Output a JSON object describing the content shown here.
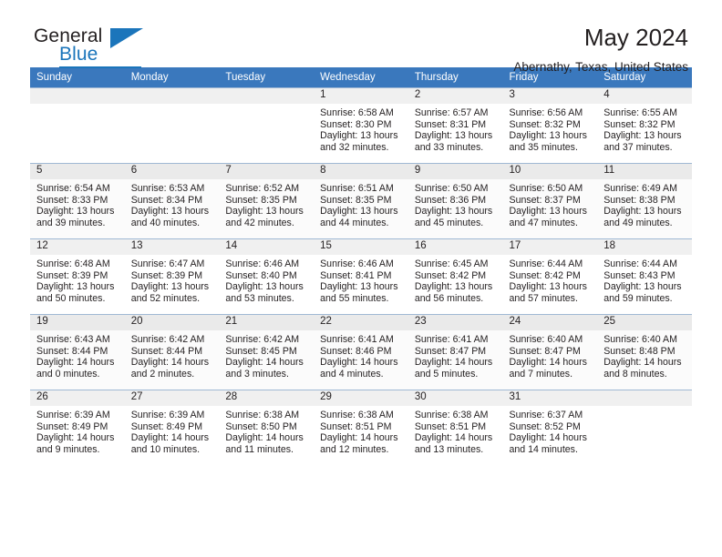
{
  "logo": {
    "word_top": "General",
    "word_bottom": "Blue",
    "icon": "triangle-mark",
    "brand_color": "#1b75bb"
  },
  "header": {
    "title": "May 2024",
    "subtitle": "Abernathy, Texas, United States"
  },
  "calendar": {
    "header_color": "#3a78bd",
    "weekday_headers": [
      "Sunday",
      "Monday",
      "Tuesday",
      "Wednesday",
      "Thursday",
      "Friday",
      "Saturday"
    ],
    "weeks": [
      [
        {
          "day": "",
          "empty": true
        },
        {
          "day": "",
          "empty": true
        },
        {
          "day": "",
          "empty": true
        },
        {
          "day": "1",
          "sunrise": "Sunrise: 6:58 AM",
          "sunset": "Sunset: 8:30 PM",
          "daylight_line1": "Daylight: 13 hours",
          "daylight_line2": "and 32 minutes."
        },
        {
          "day": "2",
          "sunrise": "Sunrise: 6:57 AM",
          "sunset": "Sunset: 8:31 PM",
          "daylight_line1": "Daylight: 13 hours",
          "daylight_line2": "and 33 minutes."
        },
        {
          "day": "3",
          "sunrise": "Sunrise: 6:56 AM",
          "sunset": "Sunset: 8:32 PM",
          "daylight_line1": "Daylight: 13 hours",
          "daylight_line2": "and 35 minutes."
        },
        {
          "day": "4",
          "sunrise": "Sunrise: 6:55 AM",
          "sunset": "Sunset: 8:32 PM",
          "daylight_line1": "Daylight: 13 hours",
          "daylight_line2": "and 37 minutes."
        }
      ],
      [
        {
          "day": "5",
          "sunrise": "Sunrise: 6:54 AM",
          "sunset": "Sunset: 8:33 PM",
          "daylight_line1": "Daylight: 13 hours",
          "daylight_line2": "and 39 minutes."
        },
        {
          "day": "6",
          "sunrise": "Sunrise: 6:53 AM",
          "sunset": "Sunset: 8:34 PM",
          "daylight_line1": "Daylight: 13 hours",
          "daylight_line2": "and 40 minutes."
        },
        {
          "day": "7",
          "sunrise": "Sunrise: 6:52 AM",
          "sunset": "Sunset: 8:35 PM",
          "daylight_line1": "Daylight: 13 hours",
          "daylight_line2": "and 42 minutes."
        },
        {
          "day": "8",
          "sunrise": "Sunrise: 6:51 AM",
          "sunset": "Sunset: 8:35 PM",
          "daylight_line1": "Daylight: 13 hours",
          "daylight_line2": "and 44 minutes."
        },
        {
          "day": "9",
          "sunrise": "Sunrise: 6:50 AM",
          "sunset": "Sunset: 8:36 PM",
          "daylight_line1": "Daylight: 13 hours",
          "daylight_line2": "and 45 minutes."
        },
        {
          "day": "10",
          "sunrise": "Sunrise: 6:50 AM",
          "sunset": "Sunset: 8:37 PM",
          "daylight_line1": "Daylight: 13 hours",
          "daylight_line2": "and 47 minutes."
        },
        {
          "day": "11",
          "sunrise": "Sunrise: 6:49 AM",
          "sunset": "Sunset: 8:38 PM",
          "daylight_line1": "Daylight: 13 hours",
          "daylight_line2": "and 49 minutes."
        }
      ],
      [
        {
          "day": "12",
          "sunrise": "Sunrise: 6:48 AM",
          "sunset": "Sunset: 8:39 PM",
          "daylight_line1": "Daylight: 13 hours",
          "daylight_line2": "and 50 minutes."
        },
        {
          "day": "13",
          "sunrise": "Sunrise: 6:47 AM",
          "sunset": "Sunset: 8:39 PM",
          "daylight_line1": "Daylight: 13 hours",
          "daylight_line2": "and 52 minutes."
        },
        {
          "day": "14",
          "sunrise": "Sunrise: 6:46 AM",
          "sunset": "Sunset: 8:40 PM",
          "daylight_line1": "Daylight: 13 hours",
          "daylight_line2": "and 53 minutes."
        },
        {
          "day": "15",
          "sunrise": "Sunrise: 6:46 AM",
          "sunset": "Sunset: 8:41 PM",
          "daylight_line1": "Daylight: 13 hours",
          "daylight_line2": "and 55 minutes."
        },
        {
          "day": "16",
          "sunrise": "Sunrise: 6:45 AM",
          "sunset": "Sunset: 8:42 PM",
          "daylight_line1": "Daylight: 13 hours",
          "daylight_line2": "and 56 minutes."
        },
        {
          "day": "17",
          "sunrise": "Sunrise: 6:44 AM",
          "sunset": "Sunset: 8:42 PM",
          "daylight_line1": "Daylight: 13 hours",
          "daylight_line2": "and 57 minutes."
        },
        {
          "day": "18",
          "sunrise": "Sunrise: 6:44 AM",
          "sunset": "Sunset: 8:43 PM",
          "daylight_line1": "Daylight: 13 hours",
          "daylight_line2": "and 59 minutes."
        }
      ],
      [
        {
          "day": "19",
          "sunrise": "Sunrise: 6:43 AM",
          "sunset": "Sunset: 8:44 PM",
          "daylight_line1": "Daylight: 14 hours",
          "daylight_line2": "and 0 minutes."
        },
        {
          "day": "20",
          "sunrise": "Sunrise: 6:42 AM",
          "sunset": "Sunset: 8:44 PM",
          "daylight_line1": "Daylight: 14 hours",
          "daylight_line2": "and 2 minutes."
        },
        {
          "day": "21",
          "sunrise": "Sunrise: 6:42 AM",
          "sunset": "Sunset: 8:45 PM",
          "daylight_line1": "Daylight: 14 hours",
          "daylight_line2": "and 3 minutes."
        },
        {
          "day": "22",
          "sunrise": "Sunrise: 6:41 AM",
          "sunset": "Sunset: 8:46 PM",
          "daylight_line1": "Daylight: 14 hours",
          "daylight_line2": "and 4 minutes."
        },
        {
          "day": "23",
          "sunrise": "Sunrise: 6:41 AM",
          "sunset": "Sunset: 8:47 PM",
          "daylight_line1": "Daylight: 14 hours",
          "daylight_line2": "and 5 minutes."
        },
        {
          "day": "24",
          "sunrise": "Sunrise: 6:40 AM",
          "sunset": "Sunset: 8:47 PM",
          "daylight_line1": "Daylight: 14 hours",
          "daylight_line2": "and 7 minutes."
        },
        {
          "day": "25",
          "sunrise": "Sunrise: 6:40 AM",
          "sunset": "Sunset: 8:48 PM",
          "daylight_line1": "Daylight: 14 hours",
          "daylight_line2": "and 8 minutes."
        }
      ],
      [
        {
          "day": "26",
          "sunrise": "Sunrise: 6:39 AM",
          "sunset": "Sunset: 8:49 PM",
          "daylight_line1": "Daylight: 14 hours",
          "daylight_line2": "and 9 minutes."
        },
        {
          "day": "27",
          "sunrise": "Sunrise: 6:39 AM",
          "sunset": "Sunset: 8:49 PM",
          "daylight_line1": "Daylight: 14 hours",
          "daylight_line2": "and 10 minutes."
        },
        {
          "day": "28",
          "sunrise": "Sunrise: 6:38 AM",
          "sunset": "Sunset: 8:50 PM",
          "daylight_line1": "Daylight: 14 hours",
          "daylight_line2": "and 11 minutes."
        },
        {
          "day": "29",
          "sunrise": "Sunrise: 6:38 AM",
          "sunset": "Sunset: 8:51 PM",
          "daylight_line1": "Daylight: 14 hours",
          "daylight_line2": "and 12 minutes."
        },
        {
          "day": "30",
          "sunrise": "Sunrise: 6:38 AM",
          "sunset": "Sunset: 8:51 PM",
          "daylight_line1": "Daylight: 14 hours",
          "daylight_line2": "and 13 minutes."
        },
        {
          "day": "31",
          "sunrise": "Sunrise: 6:37 AM",
          "sunset": "Sunset: 8:52 PM",
          "daylight_line1": "Daylight: 14 hours",
          "daylight_line2": "and 14 minutes."
        },
        {
          "day": "",
          "empty": true
        }
      ]
    ]
  }
}
